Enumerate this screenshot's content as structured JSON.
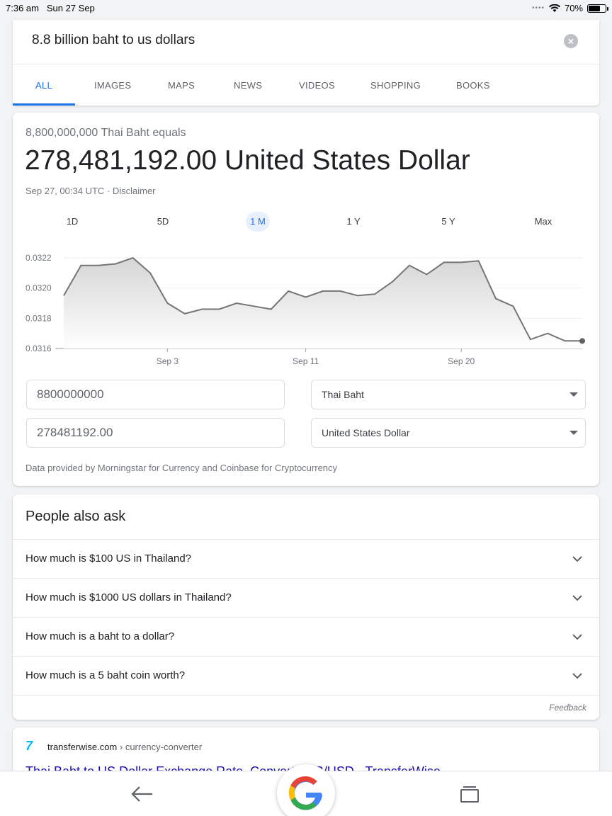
{
  "status_bar": {
    "time": "7:36 am",
    "date": "Sun 27 Sep",
    "battery": "70%"
  },
  "search": {
    "query": "8.8 billion baht to us dollars",
    "tabs": [
      {
        "label": "ALL",
        "active": true
      },
      {
        "label": "IMAGES",
        "active": false
      },
      {
        "label": "MAPS",
        "active": false
      },
      {
        "label": "NEWS",
        "active": false
      },
      {
        "label": "VIDEOS",
        "active": false
      },
      {
        "label": "SHOPPING",
        "active": false
      },
      {
        "label": "BOOKS",
        "active": false
      }
    ]
  },
  "converter": {
    "equals_line": "8,800,000,000 Thai Baht equals",
    "result": "278,481,192.00 United States Dollar",
    "updated": "Sep 27, 00:34 UTC · Disclaimer",
    "ranges": [
      "1D",
      "5D",
      "1 M",
      "1 Y",
      "5 Y",
      "Max"
    ],
    "active_range": "1 M",
    "amount_from": "8800000000",
    "amount_to": "278481192.00",
    "currency_from": "Thai Baht",
    "currency_to": "United States Dollar",
    "source_note": "Data provided by Morningstar for Currency and Coinbase for Cryptocurrency"
  },
  "chart_data": {
    "type": "area",
    "y_ticks": [
      "0.0322",
      "0.0320",
      "0.0318",
      "0.0316"
    ],
    "ylim": [
      0.0316,
      0.0322
    ],
    "x_ticks": [
      {
        "label": "Sep 3",
        "index": 6
      },
      {
        "label": "Sep 11",
        "index": 14
      },
      {
        "label": "Sep 20",
        "index": 23
      }
    ],
    "values": [
      0.03195,
      0.03215,
      0.03215,
      0.03216,
      0.0322,
      0.0321,
      0.0319,
      0.03183,
      0.03186,
      0.03186,
      0.0319,
      0.03188,
      0.03186,
      0.03198,
      0.03194,
      0.03198,
      0.03198,
      0.03195,
      0.03196,
      0.03204,
      0.03215,
      0.03209,
      0.03217,
      0.03217,
      0.03218,
      0.03193,
      0.03188,
      0.03166,
      0.0317,
      0.03165,
      0.03165
    ],
    "line_color": "#757575",
    "fill_color": "#e8e8e8"
  },
  "people_also_ask": {
    "title": "People also ask",
    "questions": [
      "How much is $100 US in Thailand?",
      "How much is $1000 US dollars in Thailand?",
      "How much is a baht to a dollar?",
      "How much is a 5 baht coin worth?"
    ],
    "feedback": "Feedback"
  },
  "result": {
    "site": "transferwise.com",
    "crumb": "› currency-converter",
    "title": "Thai Baht to US Dollar Exchange Rate. Convert THB/USD - TransferWise"
  },
  "colors": {
    "accent": "#1a73e8",
    "link": "#1a0dab"
  }
}
